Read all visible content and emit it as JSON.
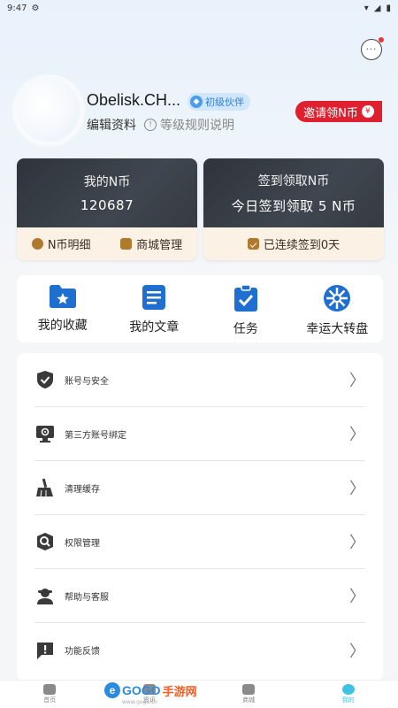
{
  "status_bar": {
    "time": "9:47"
  },
  "profile": {
    "username": "Obelisk.CH...",
    "level_badge": "初级伙伴",
    "edit_profile": "编辑资料",
    "level_rules": "等级规则说明",
    "invite_button": "邀请领N币"
  },
  "coin_card": {
    "title": "我的N币",
    "amount": "120687",
    "coin_detail": "N币明细",
    "shop_manage": "商城管理"
  },
  "checkin_card": {
    "title": "签到领取N币",
    "subtitle": "今日签到领取 5 N币",
    "streak": "已连续签到0天"
  },
  "quick_actions": [
    {
      "label": "我的收藏",
      "icon": "folder-star-icon"
    },
    {
      "label": "我的文章",
      "icon": "document-icon"
    },
    {
      "label": "任务",
      "icon": "clipboard-check-icon"
    },
    {
      "label": "幸运大转盘",
      "icon": "wheel-icon"
    }
  ],
  "menu": [
    {
      "label": "账号与安全",
      "icon": "shield-check-icon"
    },
    {
      "label": "第三方账号绑定",
      "icon": "monitor-gear-icon"
    },
    {
      "label": "清理缓存",
      "icon": "broom-icon"
    },
    {
      "label": "权限管理",
      "icon": "key-search-icon"
    },
    {
      "label": "帮助与客服",
      "icon": "support-agent-icon"
    },
    {
      "label": "功能反馈",
      "icon": "feedback-icon"
    }
  ],
  "tabbar": [
    {
      "label": "首页",
      "icon": "home-icon"
    },
    {
      "label": "资讯",
      "icon": "news-icon"
    },
    {
      "label": "商城",
      "icon": "shop-icon"
    },
    {
      "label": "我的",
      "icon": "profile-icon"
    }
  ],
  "watermark": {
    "text": "GOGO",
    "sub": "手游网",
    "url": "www.gogo.cn"
  },
  "colors": {
    "accent": "#2f7fd8",
    "invite": "#e0202e",
    "card_dark": "#363b42",
    "card_light": "#fbf1e4",
    "tab_active": "#3fc3e0"
  }
}
